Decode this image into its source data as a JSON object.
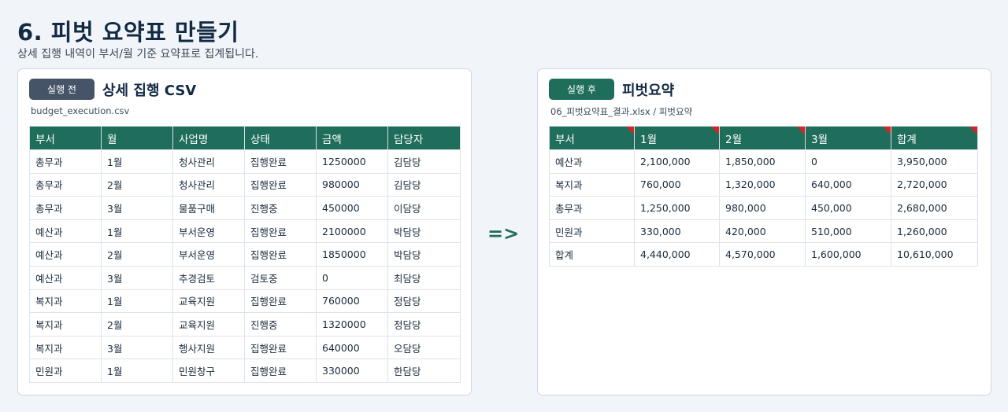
{
  "header": {
    "title": "6. 피벗 요약표 만들기",
    "subtitle": "상세 집행 내역이 부서/월 기준 요약표로 집계됩니다."
  },
  "left_panel": {
    "badge": "실행 전",
    "title": "상세 집행 CSV",
    "file": "budget_execution.csv",
    "columns": [
      "부서",
      "월",
      "사업명",
      "상태",
      "금액",
      "담당자"
    ],
    "rows": [
      [
        "총무과",
        "1월",
        "청사관리",
        "집행완료",
        "1250000",
        "김담당"
      ],
      [
        "총무과",
        "2월",
        "청사관리",
        "집행완료",
        "980000",
        "김담당"
      ],
      [
        "총무과",
        "3월",
        "물품구매",
        "진행중",
        "450000",
        "이담당"
      ],
      [
        "예산과",
        "1월",
        "부서운영",
        "집행완료",
        "2100000",
        "박담당"
      ],
      [
        "예산과",
        "2월",
        "부서운영",
        "집행완료",
        "1850000",
        "박담당"
      ],
      [
        "예산과",
        "3월",
        "추경검토",
        "검토중",
        "0",
        "최담당"
      ],
      [
        "복지과",
        "1월",
        "교육지원",
        "집행완료",
        "760000",
        "정담당"
      ],
      [
        "복지과",
        "2월",
        "교육지원",
        "진행중",
        "1320000",
        "정담당"
      ],
      [
        "복지과",
        "3월",
        "행사지원",
        "집행완료",
        "640000",
        "오담당"
      ],
      [
        "민원과",
        "1월",
        "민원창구",
        "집행완료",
        "330000",
        "한담당"
      ]
    ]
  },
  "arrow": "=>",
  "right_panel": {
    "badge": "실행 후",
    "title": "피벗요약",
    "file": "06_피벗요약표_결과.xlsx / 피벗요약",
    "columns": [
      "부서",
      "1월",
      "2월",
      "3월",
      "합계"
    ],
    "rows": [
      [
        "예산과",
        "2,100,000",
        "1,850,000",
        "0",
        "3,950,000"
      ],
      [
        "복지과",
        "760,000",
        "1,320,000",
        "640,000",
        "2,720,000"
      ],
      [
        "총무과",
        "1,250,000",
        "980,000",
        "450,000",
        "2,680,000"
      ],
      [
        "민원과",
        "330,000",
        "420,000",
        "510,000",
        "1,260,000"
      ],
      [
        "합계",
        "4,440,000",
        "4,570,000",
        "1,600,000",
        "10,610,000"
      ]
    ],
    "flag_color": "#d32626"
  },
  "colors": {
    "accent": "#1f6e5b",
    "badge_before": "#465468",
    "title": "#122a44"
  }
}
